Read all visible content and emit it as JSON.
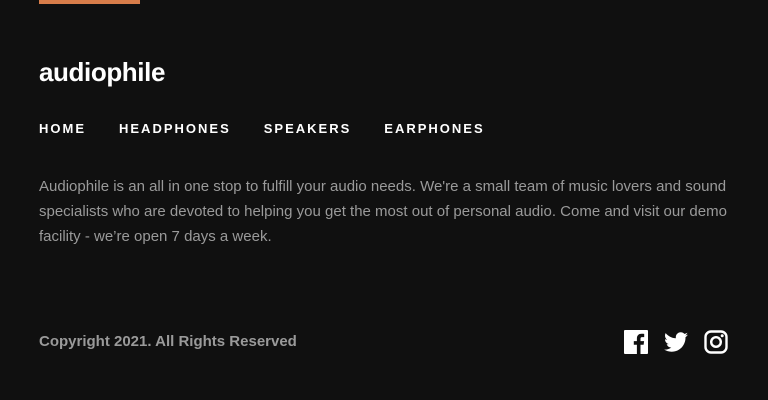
{
  "brand": {
    "logo_text": "audiophile",
    "accent_color": "#D87D4A"
  },
  "nav": {
    "items": [
      {
        "label": "HOME"
      },
      {
        "label": "HEADPHONES"
      },
      {
        "label": "SPEAKERS"
      },
      {
        "label": "EARPHONES"
      }
    ]
  },
  "footer": {
    "description": "Audiophile is an all in one stop to fulfill your audio needs. We're a small team of music lovers and sound specialists who are devoted to helping you get the most out of personal audio. Come and visit our demo facility - we’re open 7 days a week.",
    "copyright": "Copyright 2021. All Rights Reserved",
    "socials": [
      {
        "icon": "facebook-icon"
      },
      {
        "icon": "twitter-icon"
      },
      {
        "icon": "instagram-icon"
      }
    ]
  },
  "colors": {
    "background": "#101010",
    "text_primary": "#FFFFFF",
    "text_muted": "#9A9A9A"
  }
}
